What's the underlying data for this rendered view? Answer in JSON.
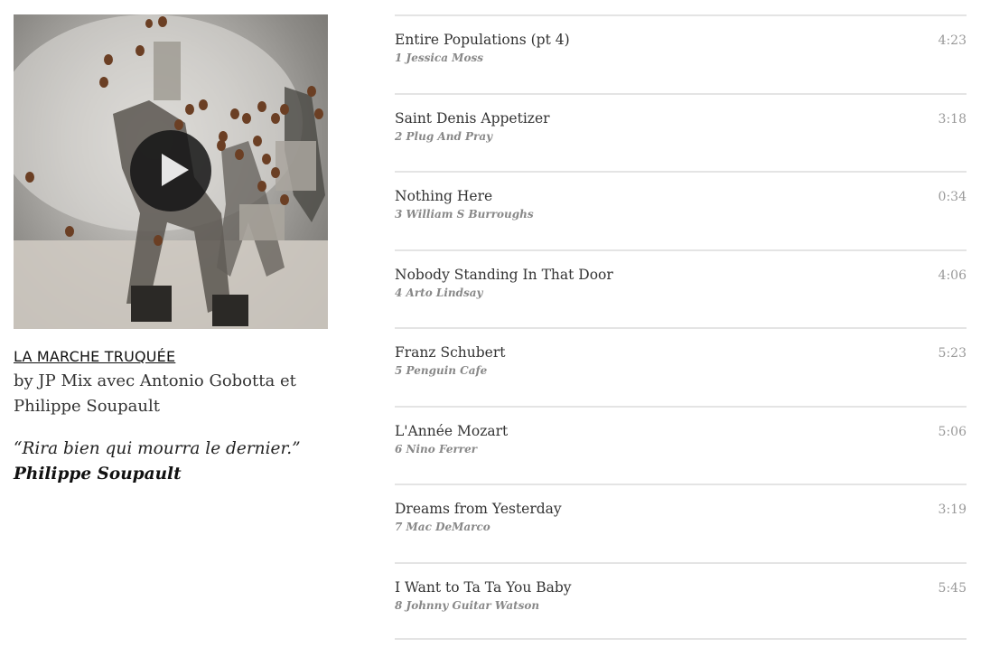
{
  "album": {
    "title": "LA MARCHE TRUQUÉE",
    "by_line": "by JP Mix avec Antonio Gobotta et Philippe Soupault",
    "quote": "“Rira bien qui mourra le dernier.”",
    "quote_author": "Philippe Soupault",
    "cover_alt": "album-cover-image"
  },
  "tracks": [
    {
      "title": "Entire Populations (pt 4)",
      "sub": "1 Jessica Moss",
      "duration": "4:23"
    },
    {
      "title": "Saint Denis Appetizer",
      "sub": "2 Plug And Pray",
      "duration": "3:18"
    },
    {
      "title": "Nothing Here",
      "sub": "3 William S Burroughs",
      "duration": "0:34"
    },
    {
      "title": "Nobody Standing In That Door",
      "sub": "4 Arto Lindsay",
      "duration": "4:06"
    },
    {
      "title": "Franz Schubert",
      "sub": "5 Penguin Cafe",
      "duration": "5:23"
    },
    {
      "title": "L'Année Mozart",
      "sub": "6 Nino Ferrer",
      "duration": "5:06"
    },
    {
      "title": "Dreams from Yesterday",
      "sub": "7 Mac DeMarco",
      "duration": "3:19"
    },
    {
      "title": "I Want to Ta Ta You Baby",
      "sub": "8 Johnny Guitar Watson",
      "duration": "5:45"
    }
  ]
}
